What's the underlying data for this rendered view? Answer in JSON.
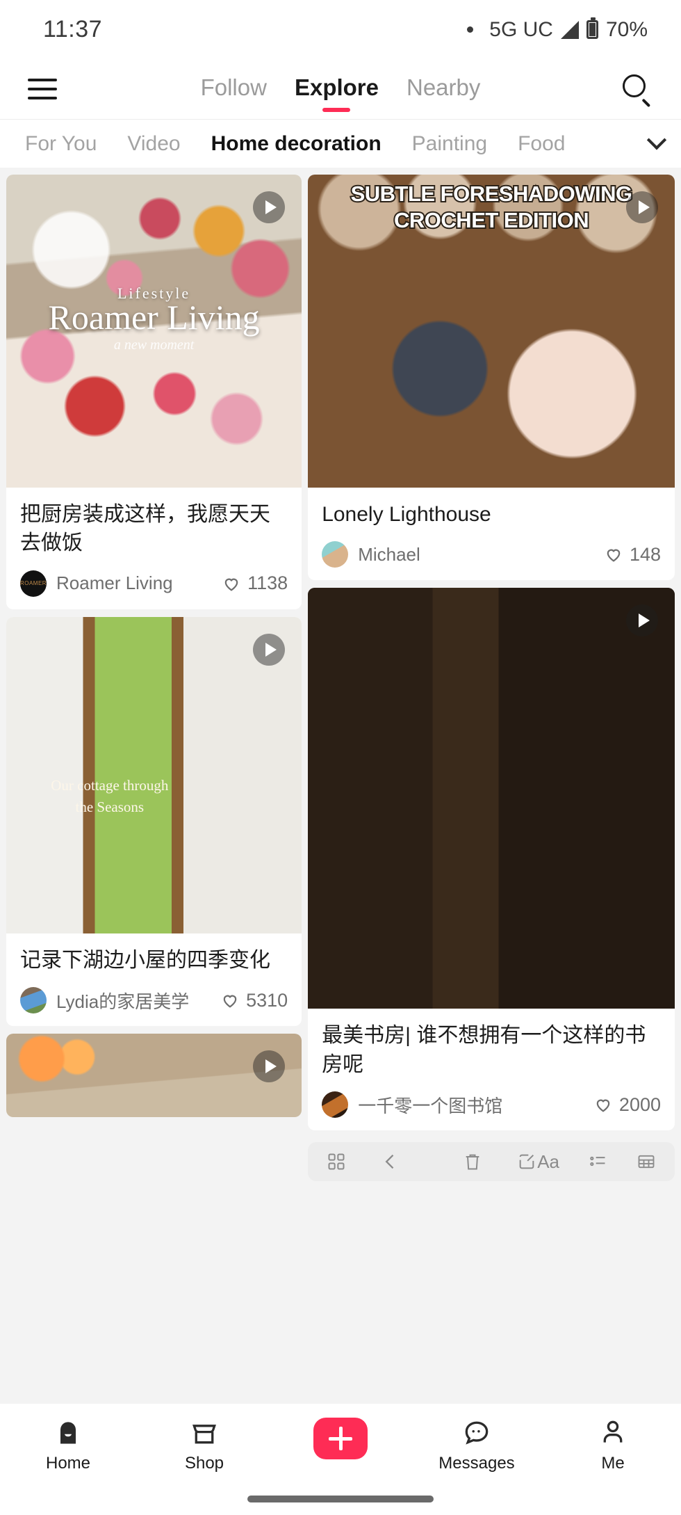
{
  "status_bar": {
    "time": "11:37",
    "network": "5G UC",
    "battery": "70%"
  },
  "top_nav": {
    "menu_icon": "hamburger-icon",
    "search_icon": "search-icon",
    "tabs": [
      {
        "label": "Follow",
        "active": false
      },
      {
        "label": "Explore",
        "active": true
      },
      {
        "label": "Nearby",
        "active": false
      }
    ],
    "accent_color": "#fe2c55"
  },
  "category_bar": {
    "expand_icon": "chevron-down-icon",
    "items": [
      {
        "label": "For You",
        "active": false
      },
      {
        "label": "Video",
        "active": false
      },
      {
        "label": "Home decoration",
        "active": true
      },
      {
        "label": "Painting",
        "active": false
      },
      {
        "label": "Food",
        "active": false
      }
    ]
  },
  "feed": {
    "left_column": [
      {
        "id": "card-kitchen",
        "title": "把厨房装成这样，我愿天天去做饭",
        "author": "Roamer Living",
        "likes": "1138",
        "is_video": true,
        "overlay": {
          "line1": "Lifestyle",
          "line2": "Roamer Living",
          "line3": "a new moment"
        }
      },
      {
        "id": "card-cottage",
        "title": "记录下湖边小屋的四季变化",
        "author": "Lydia的家居美学",
        "likes": "5310",
        "is_video": true,
        "overlay": {
          "line1": "Our cottage through the Seasons"
        }
      },
      {
        "id": "card-partial-bottom",
        "title": "",
        "author": "",
        "likes": "",
        "is_video": true,
        "overlay": {}
      }
    ],
    "right_column": [
      {
        "id": "card-crochet",
        "title": "Lonely Lighthouse",
        "author": "Michael",
        "likes": "148",
        "is_video": true,
        "overlay": {
          "line1": "SUBTLE FORESHADOWING",
          "line2": "CROCHET EDITION"
        }
      },
      {
        "id": "card-library",
        "title": "最美书房| 谁不想拥有一个这样的书房呢",
        "author": "一千零一个图书馆",
        "likes": "2000",
        "is_video": true,
        "overlay": {}
      }
    ]
  },
  "edit_toolbar": {
    "icons": [
      "grid-icon",
      "back-chevron-icon",
      "trash-icon",
      "edit-pencil-icon",
      "text-format-icon",
      "list-icon",
      "table-icon"
    ],
    "text_format_label": "Aa"
  },
  "bottom_nav": {
    "items": [
      {
        "label": "Home",
        "icon": "home-icon",
        "active": true
      },
      {
        "label": "Shop",
        "icon": "shop-icon",
        "active": false
      },
      {
        "label": "",
        "icon": "plus-icon",
        "active": false
      },
      {
        "label": "Messages",
        "icon": "message-icon",
        "active": false
      },
      {
        "label": "Me",
        "icon": "person-icon",
        "active": false
      }
    ],
    "plus_color": "#fe2c55"
  }
}
